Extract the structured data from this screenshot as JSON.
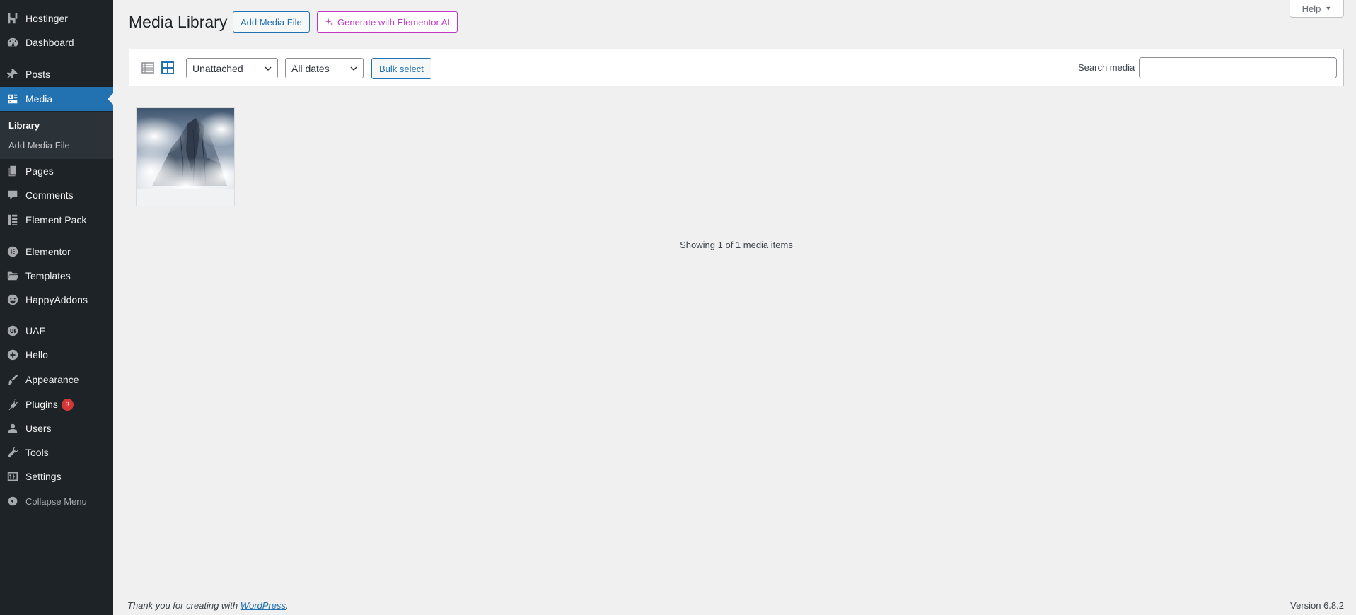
{
  "sidebar": {
    "items": [
      {
        "label": "Hostinger",
        "icon": "hostinger-icon"
      },
      {
        "label": "Dashboard",
        "icon": "dashboard-icon"
      },
      {
        "label": "Posts",
        "icon": "pin-icon"
      },
      {
        "label": "Media",
        "icon": "media-icon",
        "current": true
      },
      {
        "label": "Pages",
        "icon": "pages-icon"
      },
      {
        "label": "Comments",
        "icon": "comment-icon"
      },
      {
        "label": "Element Pack",
        "icon": "element-pack-icon"
      },
      {
        "label": "Elementor",
        "icon": "elementor-icon"
      },
      {
        "label": "Templates",
        "icon": "folder-icon"
      },
      {
        "label": "HappyAddons",
        "icon": "happy-icon"
      },
      {
        "label": "UAE",
        "icon": "uae-icon"
      },
      {
        "label": "Hello",
        "icon": "plus-circle-icon"
      },
      {
        "label": "Appearance",
        "icon": "brush-icon"
      },
      {
        "label": "Plugins",
        "icon": "plug-icon",
        "badge": "3"
      },
      {
        "label": "Users",
        "icon": "user-icon"
      },
      {
        "label": "Tools",
        "icon": "wrench-icon"
      },
      {
        "label": "Settings",
        "icon": "settings-icon"
      },
      {
        "label": "Collapse Menu",
        "icon": "collapse-icon"
      }
    ],
    "submenu": [
      {
        "label": "Library",
        "active": true
      },
      {
        "label": "Add Media File"
      }
    ]
  },
  "header": {
    "help": "Help",
    "title": "Media Library",
    "add_button": "Add Media File",
    "ai_button": "Generate with Elementor AI"
  },
  "toolbar": {
    "filter_type": "Unattached",
    "filter_date": "All dates",
    "bulk": "Bulk select",
    "search_label": "Search media",
    "search_value": ""
  },
  "main": {
    "count": "Showing 1 of 1 media items"
  },
  "footer": {
    "thanks": "Thank you for creating with",
    "link": "WordPress",
    "period": ".",
    "version": "Version 6.8.2"
  },
  "colors": {
    "sidebar_bg": "#1d2327",
    "accent": "#2271b1",
    "ai_accent": "#c036c7",
    "badge": "#d63638"
  }
}
